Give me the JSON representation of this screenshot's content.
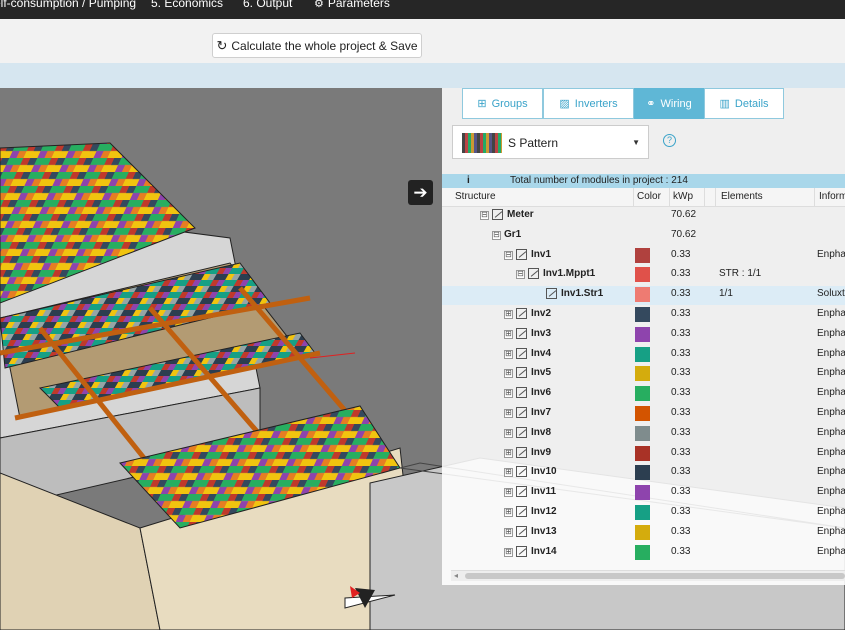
{
  "nav": {
    "items": [
      "elf-consumption / Pumping",
      "5. Economics",
      "6. Output",
      "Parameters"
    ]
  },
  "toolbar": {
    "calc_label": "Calculate the whole project & Save"
  },
  "tabs": [
    {
      "label": "Groups",
      "icon": "groups-icon"
    },
    {
      "label": "Inverters",
      "icon": "inverter-icon"
    },
    {
      "label": "Wiring",
      "icon": "wiring-icon",
      "active": true
    },
    {
      "label": "Details",
      "icon": "chart-icon"
    }
  ],
  "pattern": {
    "selected": "S Pattern",
    "help": "?"
  },
  "total": {
    "icon": "i",
    "text": "Total number of modules in project : 214"
  },
  "columns": [
    "Structure",
    "Color",
    "kWp",
    "Elements",
    "Inform"
  ],
  "rows": [
    {
      "name": "Meter",
      "kwp": "70.62",
      "elements": "",
      "info": "",
      "color": "",
      "expander": "⊟"
    },
    {
      "name": "Gr1",
      "kwp": "70.62",
      "elements": "",
      "info": "",
      "color": "",
      "expander": "⊟"
    },
    {
      "name": "Inv1",
      "kwp": "0.33",
      "elements": "",
      "info": "Enpha",
      "color": "#b0413e",
      "expander": "⊟"
    },
    {
      "name": "Inv1.Mppt1",
      "kwp": "0.33",
      "elements": "STR : 1/1",
      "info": "",
      "color": "#e0514a",
      "expander": "⊟"
    },
    {
      "name": "Inv1.Str1",
      "kwp": "0.33",
      "elements": "1/1",
      "info": "Soluxt",
      "color": "#ee7b72",
      "expander": ""
    },
    {
      "name": "Inv2",
      "kwp": "0.33",
      "elements": "",
      "info": "Enpha",
      "color": "#34495e",
      "expander": "⊞"
    },
    {
      "name": "Inv3",
      "kwp": "0.33",
      "elements": "",
      "info": "Enpha",
      "color": "#8e44ad",
      "expander": "⊞"
    },
    {
      "name": "Inv4",
      "kwp": "0.33",
      "elements": "",
      "info": "Enpha",
      "color": "#16a085",
      "expander": "⊞"
    },
    {
      "name": "Inv5",
      "kwp": "0.33",
      "elements": "",
      "info": "Enpha",
      "color": "#d4ac0d",
      "expander": "⊞"
    },
    {
      "name": "Inv6",
      "kwp": "0.33",
      "elements": "",
      "info": "Enpha",
      "color": "#27ae60",
      "expander": "⊞"
    },
    {
      "name": "Inv7",
      "kwp": "0.33",
      "elements": "",
      "info": "Enpha",
      "color": "#d35400",
      "expander": "⊞"
    },
    {
      "name": "Inv8",
      "kwp": "0.33",
      "elements": "",
      "info": "Enpha",
      "color": "#7f8c8d",
      "expander": "⊞"
    },
    {
      "name": "Inv9",
      "kwp": "0.33",
      "elements": "",
      "info": "Enpha",
      "color": "#a93226",
      "expander": "⊞"
    },
    {
      "name": "Inv10",
      "kwp": "0.33",
      "elements": "",
      "info": "Enpha",
      "color": "#2c3e50",
      "expander": "⊞"
    },
    {
      "name": "Inv11",
      "kwp": "0.33",
      "elements": "",
      "info": "Enpha",
      "color": "#8e44ad",
      "expander": "⊞"
    },
    {
      "name": "Inv12",
      "kwp": "0.33",
      "elements": "",
      "info": "Enpha",
      "color": "#16a085",
      "expander": "⊞"
    },
    {
      "name": "Inv13",
      "kwp": "0.33",
      "elements": "",
      "info": "Enpha",
      "color": "#d4ac0d",
      "expander": "⊞"
    },
    {
      "name": "Inv14",
      "kwp": "0.33",
      "elements": "",
      "info": "Enpha",
      "color": "#27ae60",
      "expander": "⊞"
    }
  ]
}
